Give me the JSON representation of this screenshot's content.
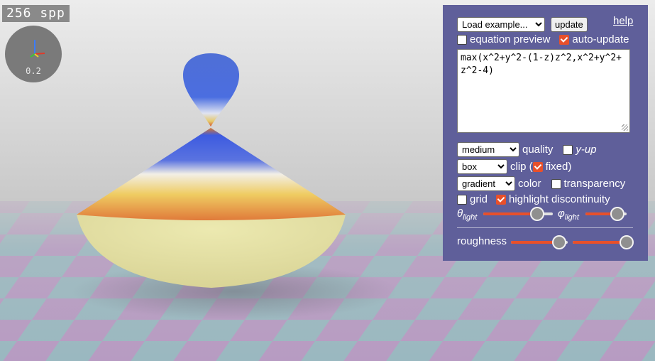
{
  "render": {
    "spp_label": "256 spp",
    "axis_scale": "0.2",
    "colors": {
      "sky_top": "#e9e9e9",
      "sky_bottom": "#c9c9c9",
      "floor_pink": "#b79bc2",
      "floor_teal": "#9ab8c0",
      "top_blob": "#4f6fd6",
      "cone_blue": "#3d5be0",
      "cone_orange": "#e08a3c",
      "bowl": "#e6e3a3"
    }
  },
  "panel": {
    "example_select": "Load example...",
    "update_button": "update",
    "help_link": "help",
    "equation_preview_label": "equation preview",
    "equation_preview_checked": false,
    "auto_update_label": "auto-update",
    "auto_update_checked": true,
    "equation": "max(x^2+y^2-(1-z)z^2,x^2+y^2+z^2-4)",
    "quality_select": "medium",
    "quality_label": "quality",
    "y_up_label": "y-up",
    "y_up_checked": false,
    "clip_select": "box",
    "clip_label": "clip (",
    "fixed_label": "fixed)",
    "fixed_checked": true,
    "color_select": "gradient",
    "color_label": "color",
    "transparency_label": "transparency",
    "transparency_checked": false,
    "grid_label": "grid",
    "grid_checked": false,
    "highlight_label": "highlight discontinuity",
    "highlight_checked": true,
    "theta_symbol": "θ",
    "theta_sub": "light",
    "theta_value": 0.78,
    "phi_symbol": "φ",
    "phi_sub": "light",
    "phi_value": 0.78,
    "roughness_label": "roughness",
    "roughness1_value": 0.85,
    "roughness2_value": 0.95,
    "accent_color": "#e8502a",
    "panel_color": "#5f5f9a"
  }
}
